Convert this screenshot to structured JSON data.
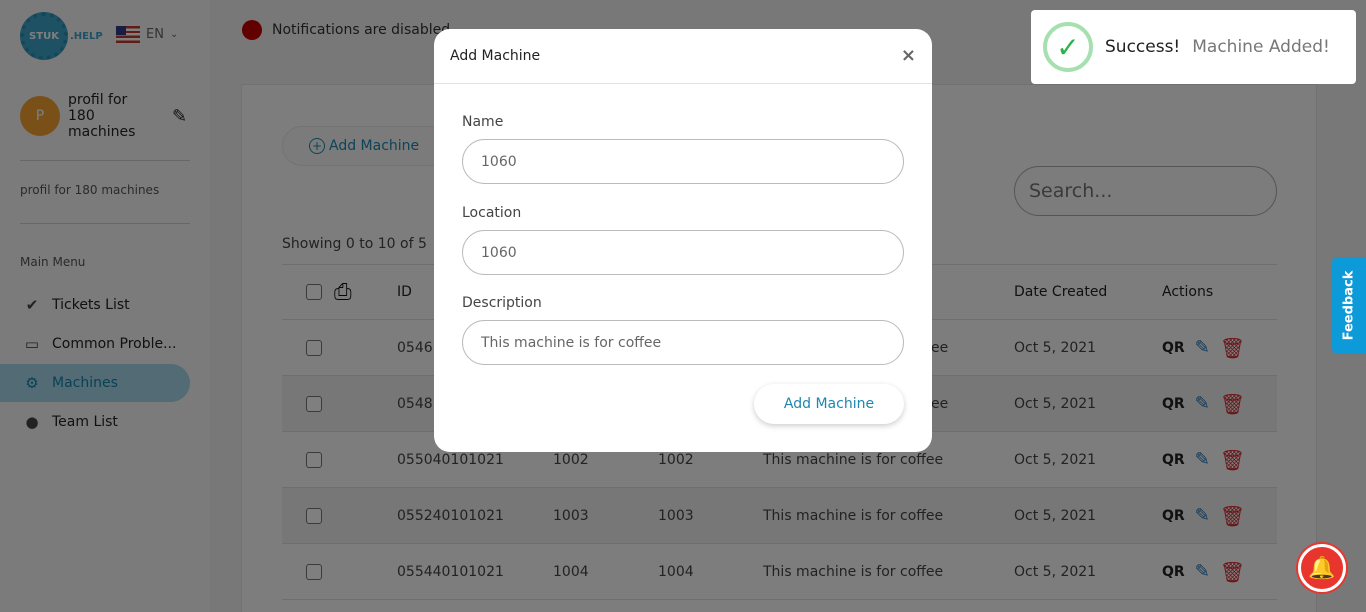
{
  "sidebar": {
    "logo_text": "STUK",
    "logo_suffix": ".HELP",
    "language": "EN",
    "profile_initial": "P",
    "profile_name": "profil for 180 machines",
    "profile_subtitle": "profil for 180 machines",
    "menu_heading": "Main Menu",
    "items": [
      {
        "label": "Tickets List",
        "icon": "check-circle-icon"
      },
      {
        "label": "Common Proble...",
        "icon": "tag-icon"
      },
      {
        "label": "Machines",
        "icon": "machine-icon",
        "active": true
      },
      {
        "label": "Team List",
        "icon": "team-icon"
      }
    ]
  },
  "notification": {
    "text": "Notifications are disabled"
  },
  "toolbar": {
    "add_label": "Add Machine",
    "search_placeholder": "Search..."
  },
  "showing": "Showing 0 to 10 of 5",
  "table": {
    "headers": [
      "ID",
      "Date Created",
      "Actions"
    ],
    "rows": [
      {
        "id": "0546",
        "name": "",
        "location": "",
        "description": "ee",
        "date": "Oct 5, 2021"
      },
      {
        "id": "0548",
        "name": "",
        "location": "",
        "description": "ee",
        "date": "Oct 5, 2021"
      },
      {
        "id": "055040101021",
        "name": "1002",
        "location": "1002",
        "description": "This machine is for coffee",
        "date": "Oct 5, 2021"
      },
      {
        "id": "055240101021",
        "name": "1003",
        "location": "1003",
        "description": "This machine is for coffee",
        "date": "Oct 5, 2021"
      },
      {
        "id": "055440101021",
        "name": "1004",
        "location": "1004",
        "description": "This machine is for coffee",
        "date": "Oct 5, 2021"
      }
    ],
    "qr_label": "QR"
  },
  "modal": {
    "title": "Add Machine",
    "close": "×",
    "name_label": "Name",
    "name_value": "1060",
    "location_label": "Location",
    "location_value": "1060",
    "description_label": "Description",
    "description_value": "This machine is for coffee",
    "submit_label": "Add Machine"
  },
  "toast": {
    "title": "Success!",
    "message": "Machine Added!"
  },
  "feedback": {
    "label": "Feedback"
  },
  "colors": {
    "accent": "#1d87b0",
    "active_bg": "#a4d7e9",
    "success": "#2eb14a",
    "danger": "#d8262b"
  }
}
